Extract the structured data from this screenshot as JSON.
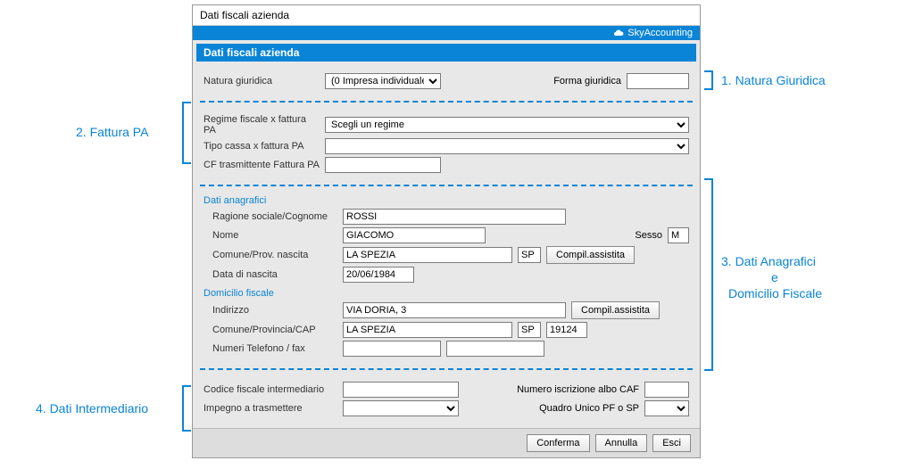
{
  "window": {
    "title": "Dati fiscali azienda",
    "brand": "SkyAccounting"
  },
  "section_header": "Dati fiscali azienda",
  "natura": {
    "label": "Natura giuridica",
    "value": "(0 Impresa individuale",
    "forma_label": "Forma giuridica",
    "forma_value": ""
  },
  "fatturapa": {
    "regime_label": "Regime fiscale x fattura PA",
    "regime_value": "Scegli un regime",
    "cassa_label": "Tipo cassa x fattura PA",
    "cassa_value": "",
    "cf_label": "CF trasmittente Fattura PA",
    "cf_value": ""
  },
  "anagrafici": {
    "group": "Dati anagrafici",
    "ragione_label": "Ragione sociale/Cognome",
    "ragione_value": "ROSSI",
    "nome_label": "Nome",
    "nome_value": "GIACOMO",
    "sesso_label": "Sesso",
    "sesso_value": "M",
    "comune_label": "Comune/Prov. nascita",
    "comune_value": "LA SPEZIA",
    "prov_value": "SP",
    "compil_btn": "Compil.assistita",
    "data_label": "Data di nascita",
    "data_value": "20/06/1984"
  },
  "domicilio": {
    "group": "Domicilio fiscale",
    "indirizzo_label": "Indirizzo",
    "indirizzo_value": "VIA DORIA, 3",
    "compil_btn": "Compil.assistita",
    "comune_label": "Comune/Provincia/CAP",
    "comune_value": "LA SPEZIA",
    "prov_value": "SP",
    "cap_value": "19124",
    "tel_label": "Numeri Telefono / fax",
    "tel_value": "",
    "fax_value": ""
  },
  "intermediario": {
    "cf_label": "Codice fiscale intermediario",
    "cf_value": "",
    "caf_label": "Numero iscrizione albo CAF",
    "caf_value": "",
    "impegno_label": "Impegno a trasmettere",
    "impegno_value": "",
    "quadro_label": "Quadro Unico PF o SP",
    "quadro_value": ""
  },
  "buttons": {
    "conferma": "Conferma",
    "annulla": "Annulla",
    "esci": "Esci"
  },
  "callouts": {
    "c1": "1. Natura Giuridica",
    "c2": "2. Fattura PA",
    "c3a": "3. Dati Anagrafici",
    "c3b": "e",
    "c3c": "Domicilio Fiscale",
    "c4": "4. Dati Intermediario"
  }
}
